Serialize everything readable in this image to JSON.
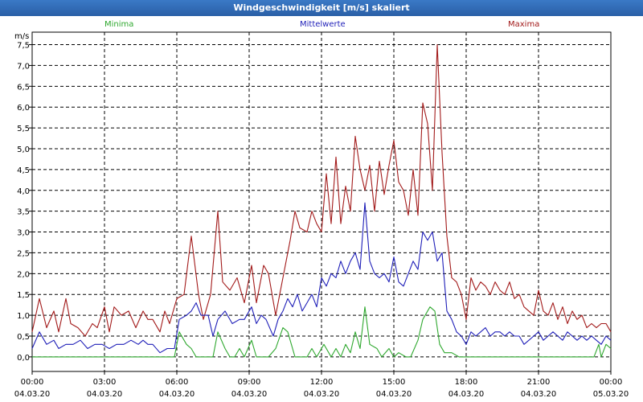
{
  "window": {
    "title": "Windgeschwindigkeit [m/s] skaliert"
  },
  "legend": [
    {
      "label": "Minima",
      "color": "#2fa82f"
    },
    {
      "label": "Mittelwerte",
      "color": "#1f1fb8"
    },
    {
      "label": "Maxima",
      "color": "#a21a1a"
    }
  ],
  "chart_data": {
    "type": "line",
    "title": "Windgeschwindigkeit [m/s] skaliert",
    "ylabel": "m/s",
    "xlabel": "",
    "ylim": [
      -0.35,
      7.8
    ],
    "xlim": [
      0,
      24
    ],
    "grid": true,
    "y_ticks": [
      "0,0",
      "0,5",
      "1,0",
      "1,5",
      "2,0",
      "2,5",
      "3,0",
      "3,5",
      "4,0",
      "4,5",
      "5,0",
      "5,5",
      "6,0",
      "6,5",
      "7,0",
      "7,5"
    ],
    "x_ticks": [
      {
        "time": "00:00",
        "date": "04.03.20"
      },
      {
        "time": "03:00",
        "date": "04.03.20"
      },
      {
        "time": "06:00",
        "date": "04.03.20"
      },
      {
        "time": "09:00",
        "date": "04.03.20"
      },
      {
        "time": "12:00",
        "date": "04.03.20"
      },
      {
        "time": "15:00",
        "date": "04.03.20"
      },
      {
        "time": "18:00",
        "date": "04.03.20"
      },
      {
        "time": "21:00",
        "date": "04.03.20"
      },
      {
        "time": "00:00",
        "date": "05.03.20"
      }
    ],
    "series": [
      {
        "name": "Maxima",
        "color": "#a21a1a",
        "points": [
          [
            0.0,
            0.6
          ],
          [
            0.3,
            1.4
          ],
          [
            0.6,
            0.7
          ],
          [
            0.9,
            1.1
          ],
          [
            1.1,
            0.6
          ],
          [
            1.4,
            1.4
          ],
          [
            1.6,
            0.8
          ],
          [
            1.9,
            0.7
          ],
          [
            2.2,
            0.5
          ],
          [
            2.5,
            0.8
          ],
          [
            2.7,
            0.7
          ],
          [
            3.0,
            1.2
          ],
          [
            3.2,
            0.6
          ],
          [
            3.4,
            1.2
          ],
          [
            3.7,
            1.0
          ],
          [
            4.0,
            1.1
          ],
          [
            4.3,
            0.7
          ],
          [
            4.6,
            1.1
          ],
          [
            4.8,
            0.9
          ],
          [
            5.0,
            0.9
          ],
          [
            5.3,
            0.6
          ],
          [
            5.5,
            1.1
          ],
          [
            5.7,
            0.8
          ],
          [
            6.0,
            1.4
          ],
          [
            6.3,
            1.5
          ],
          [
            6.6,
            2.9
          ],
          [
            6.9,
            1.5
          ],
          [
            7.1,
            0.9
          ],
          [
            7.4,
            1.5
          ],
          [
            7.7,
            3.5
          ],
          [
            7.9,
            1.8
          ],
          [
            8.2,
            1.6
          ],
          [
            8.5,
            1.9
          ],
          [
            8.8,
            1.3
          ],
          [
            9.1,
            2.2
          ],
          [
            9.3,
            1.3
          ],
          [
            9.6,
            2.2
          ],
          [
            9.8,
            2.0
          ],
          [
            10.1,
            1.0
          ],
          [
            10.4,
            1.9
          ],
          [
            10.7,
            2.8
          ],
          [
            10.9,
            3.5
          ],
          [
            11.1,
            3.1
          ],
          [
            11.4,
            3.0
          ],
          [
            11.6,
            3.5
          ],
          [
            11.8,
            3.2
          ],
          [
            12.0,
            3.0
          ],
          [
            12.2,
            4.4
          ],
          [
            12.4,
            3.2
          ],
          [
            12.6,
            4.8
          ],
          [
            12.8,
            3.2
          ],
          [
            13.0,
            4.1
          ],
          [
            13.2,
            3.5
          ],
          [
            13.4,
            5.3
          ],
          [
            13.6,
            4.5
          ],
          [
            13.8,
            4.0
          ],
          [
            14.0,
            4.6
          ],
          [
            14.2,
            3.5
          ],
          [
            14.4,
            4.7
          ],
          [
            14.6,
            3.9
          ],
          [
            14.8,
            4.6
          ],
          [
            15.0,
            5.2
          ],
          [
            15.2,
            4.2
          ],
          [
            15.4,
            4.0
          ],
          [
            15.6,
            3.4
          ],
          [
            15.8,
            4.5
          ],
          [
            16.0,
            3.4
          ],
          [
            16.2,
            6.1
          ],
          [
            16.4,
            5.6
          ],
          [
            16.6,
            4.0
          ],
          [
            16.8,
            7.5
          ],
          [
            17.0,
            4.9
          ],
          [
            17.2,
            2.9
          ],
          [
            17.4,
            1.9
          ],
          [
            17.6,
            1.8
          ],
          [
            17.8,
            1.5
          ],
          [
            18.0,
            0.9
          ],
          [
            18.2,
            1.9
          ],
          [
            18.4,
            1.6
          ],
          [
            18.6,
            1.8
          ],
          [
            18.8,
            1.7
          ],
          [
            19.0,
            1.5
          ],
          [
            19.2,
            1.8
          ],
          [
            19.4,
            1.6
          ],
          [
            19.6,
            1.5
          ],
          [
            19.8,
            1.8
          ],
          [
            20.0,
            1.4
          ],
          [
            20.2,
            1.5
          ],
          [
            20.4,
            1.2
          ],
          [
            20.6,
            1.1
          ],
          [
            20.8,
            1.0
          ],
          [
            21.0,
            1.6
          ],
          [
            21.2,
            1.1
          ],
          [
            21.4,
            1.0
          ],
          [
            21.6,
            1.3
          ],
          [
            21.8,
            0.9
          ],
          [
            22.0,
            1.2
          ],
          [
            22.2,
            0.8
          ],
          [
            22.4,
            1.1
          ],
          [
            22.6,
            0.9
          ],
          [
            22.8,
            1.0
          ],
          [
            23.0,
            0.7
          ],
          [
            23.2,
            0.8
          ],
          [
            23.4,
            0.7
          ],
          [
            23.6,
            0.8
          ],
          [
            23.8,
            0.8
          ],
          [
            24.0,
            0.6
          ]
        ]
      },
      {
        "name": "Mittelwerte",
        "color": "#1f1fb8",
        "points": [
          [
            0.0,
            0.2
          ],
          [
            0.3,
            0.6
          ],
          [
            0.6,
            0.3
          ],
          [
            0.9,
            0.4
          ],
          [
            1.1,
            0.2
          ],
          [
            1.4,
            0.3
          ],
          [
            1.7,
            0.3
          ],
          [
            2.0,
            0.4
          ],
          [
            2.3,
            0.2
          ],
          [
            2.6,
            0.3
          ],
          [
            2.9,
            0.3
          ],
          [
            3.2,
            0.2
          ],
          [
            3.5,
            0.3
          ],
          [
            3.8,
            0.3
          ],
          [
            4.1,
            0.4
          ],
          [
            4.4,
            0.3
          ],
          [
            4.6,
            0.4
          ],
          [
            4.8,
            0.3
          ],
          [
            5.0,
            0.3
          ],
          [
            5.3,
            0.1
          ],
          [
            5.6,
            0.2
          ],
          [
            5.9,
            0.2
          ],
          [
            6.1,
            0.9
          ],
          [
            6.4,
            1.0
          ],
          [
            6.6,
            1.1
          ],
          [
            6.8,
            1.3
          ],
          [
            7.0,
            1.0
          ],
          [
            7.3,
            1.0
          ],
          [
            7.5,
            0.5
          ],
          [
            7.7,
            0.9
          ],
          [
            8.0,
            1.1
          ],
          [
            8.3,
            0.8
          ],
          [
            8.6,
            0.9
          ],
          [
            8.8,
            0.9
          ],
          [
            9.1,
            1.2
          ],
          [
            9.3,
            0.8
          ],
          [
            9.5,
            1.0
          ],
          [
            9.7,
            0.9
          ],
          [
            10.0,
            0.5
          ],
          [
            10.2,
            0.9
          ],
          [
            10.4,
            1.1
          ],
          [
            10.6,
            1.4
          ],
          [
            10.8,
            1.2
          ],
          [
            11.0,
            1.5
          ],
          [
            11.2,
            1.1
          ],
          [
            11.4,
            1.3
          ],
          [
            11.6,
            1.5
          ],
          [
            11.8,
            1.2
          ],
          [
            12.0,
            1.9
          ],
          [
            12.2,
            1.7
          ],
          [
            12.4,
            2.0
          ],
          [
            12.6,
            1.9
          ],
          [
            12.8,
            2.3
          ],
          [
            13.0,
            2.0
          ],
          [
            13.2,
            2.3
          ],
          [
            13.4,
            2.5
          ],
          [
            13.6,
            2.1
          ],
          [
            13.8,
            3.7
          ],
          [
            14.0,
            2.3
          ],
          [
            14.2,
            2.0
          ],
          [
            14.4,
            1.9
          ],
          [
            14.6,
            2.0
          ],
          [
            14.8,
            1.8
          ],
          [
            15.0,
            2.4
          ],
          [
            15.2,
            1.8
          ],
          [
            15.4,
            1.7
          ],
          [
            15.6,
            2.0
          ],
          [
            15.8,
            2.3
          ],
          [
            16.0,
            2.1
          ],
          [
            16.2,
            3.0
          ],
          [
            16.4,
            2.8
          ],
          [
            16.6,
            3.0
          ],
          [
            16.8,
            2.3
          ],
          [
            17.0,
            2.5
          ],
          [
            17.2,
            1.1
          ],
          [
            17.4,
            0.9
          ],
          [
            17.6,
            0.6
          ],
          [
            17.8,
            0.5
          ],
          [
            18.0,
            0.3
          ],
          [
            18.2,
            0.6
          ],
          [
            18.4,
            0.5
          ],
          [
            18.6,
            0.6
          ],
          [
            18.8,
            0.7
          ],
          [
            19.0,
            0.5
          ],
          [
            19.2,
            0.6
          ],
          [
            19.4,
            0.6
          ],
          [
            19.6,
            0.5
          ],
          [
            19.8,
            0.6
          ],
          [
            20.0,
            0.5
          ],
          [
            20.2,
            0.5
          ],
          [
            20.4,
            0.3
          ],
          [
            20.6,
            0.4
          ],
          [
            20.8,
            0.5
          ],
          [
            21.0,
            0.6
          ],
          [
            21.2,
            0.4
          ],
          [
            21.4,
            0.5
          ],
          [
            21.6,
            0.6
          ],
          [
            21.8,
            0.5
          ],
          [
            22.0,
            0.4
          ],
          [
            22.2,
            0.6
          ],
          [
            22.4,
            0.5
          ],
          [
            22.6,
            0.4
          ],
          [
            22.8,
            0.5
          ],
          [
            23.0,
            0.4
          ],
          [
            23.2,
            0.5
          ],
          [
            23.4,
            0.4
          ],
          [
            23.6,
            0.3
          ],
          [
            23.8,
            0.5
          ],
          [
            24.0,
            0.4
          ]
        ]
      },
      {
        "name": "Minima",
        "color": "#2fa82f",
        "points": [
          [
            0.0,
            0.0
          ],
          [
            5.9,
            0.0
          ],
          [
            6.1,
            0.6
          ],
          [
            6.4,
            0.3
          ],
          [
            6.6,
            0.2
          ],
          [
            6.8,
            0.0
          ],
          [
            7.5,
            0.0
          ],
          [
            7.7,
            0.6
          ],
          [
            8.0,
            0.2
          ],
          [
            8.2,
            0.0
          ],
          [
            8.4,
            0.0
          ],
          [
            8.6,
            0.2
          ],
          [
            8.8,
            0.0
          ],
          [
            9.1,
            0.4
          ],
          [
            9.3,
            0.0
          ],
          [
            9.8,
            0.0
          ],
          [
            10.1,
            0.2
          ],
          [
            10.4,
            0.7
          ],
          [
            10.6,
            0.6
          ],
          [
            10.9,
            0.0
          ],
          [
            11.4,
            0.0
          ],
          [
            11.6,
            0.2
          ],
          [
            11.8,
            0.0
          ],
          [
            12.1,
            0.3
          ],
          [
            12.4,
            0.0
          ],
          [
            12.6,
            0.2
          ],
          [
            12.8,
            0.0
          ],
          [
            13.0,
            0.3
          ],
          [
            13.2,
            0.1
          ],
          [
            13.4,
            0.6
          ],
          [
            13.6,
            0.2
          ],
          [
            13.8,
            1.2
          ],
          [
            14.0,
            0.3
          ],
          [
            14.3,
            0.2
          ],
          [
            14.5,
            0.0
          ],
          [
            14.8,
            0.2
          ],
          [
            15.0,
            0.0
          ],
          [
            15.2,
            0.1
          ],
          [
            15.5,
            0.0
          ],
          [
            15.7,
            0.0
          ],
          [
            16.0,
            0.4
          ],
          [
            16.2,
            0.9
          ],
          [
            16.5,
            1.2
          ],
          [
            16.7,
            1.1
          ],
          [
            16.9,
            0.3
          ],
          [
            17.1,
            0.1
          ],
          [
            17.4,
            0.1
          ],
          [
            17.7,
            0.0
          ],
          [
            23.3,
            0.0
          ],
          [
            23.5,
            0.3
          ],
          [
            23.6,
            0.0
          ],
          [
            23.8,
            0.3
          ],
          [
            24.0,
            0.2
          ]
        ]
      }
    ]
  }
}
